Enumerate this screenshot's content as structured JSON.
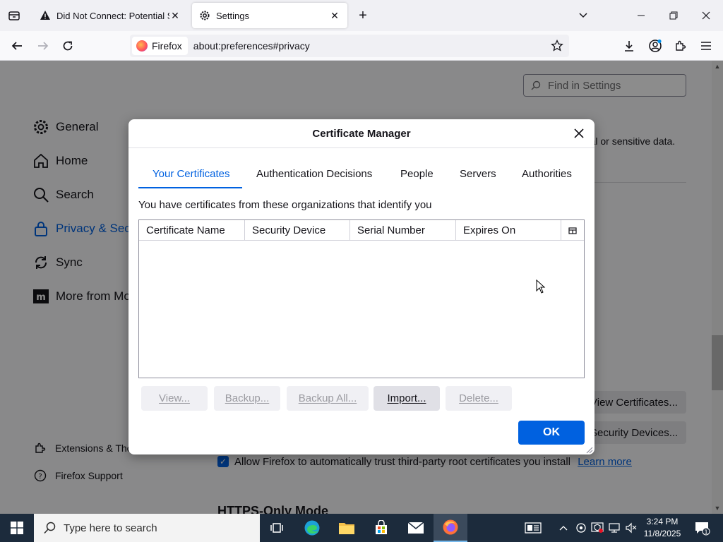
{
  "tabs": [
    {
      "title": "Did Not Connect: Potential Secu",
      "icon": "warning-icon",
      "active": false
    },
    {
      "title": "Settings",
      "icon": "gear-icon",
      "active": true
    }
  ],
  "urlbar": {
    "identity_label": "Firefox",
    "url": "about:preferences#privacy"
  },
  "settings": {
    "find_placeholder": "Find in Settings",
    "sidebar": [
      {
        "label": "General",
        "icon": "gear-icon"
      },
      {
        "label": "Home",
        "icon": "home-icon"
      },
      {
        "label": "Search",
        "icon": "search-icon"
      },
      {
        "label": "Privacy & Secu",
        "icon": "lock-icon"
      },
      {
        "label": "Sync",
        "icon": "sync-icon"
      },
      {
        "label": "More from Mo",
        "icon": "mozilla-icon"
      }
    ],
    "sidebar_footer": [
      {
        "label": "Extensions & The",
        "icon": "puzzle-icon"
      },
      {
        "label": "Firefox Support",
        "icon": "help-icon"
      }
    ],
    "bg_fragment": "onal or sensitive data.",
    "view_certificates": "View Certificates...",
    "security_devices": "Security Devices...",
    "trust_checkbox_label": "Allow Firefox to automatically trust third-party root certificates you install",
    "learn_more": "Learn more",
    "https_heading": "HTTPS-Only Mode"
  },
  "dialog": {
    "title": "Certificate Manager",
    "tabs": [
      "Your Certificates",
      "Authentication Decisions",
      "People",
      "Servers",
      "Authorities"
    ],
    "active_tab": "Your Certificates",
    "description": "You have certificates from these organizations that identify you",
    "columns": [
      "Certificate Name",
      "Security Device",
      "Serial Number",
      "Expires On"
    ],
    "rows": [],
    "buttons": {
      "view": "View...",
      "backup": "Backup...",
      "backup_all": "Backup All...",
      "import": "Import...",
      "delete": "Delete..."
    },
    "ok": "OK"
  },
  "taskbar": {
    "search_placeholder": "Type here to search",
    "time": "3:24 PM",
    "date": "11/8/2025",
    "notification_count": "1"
  },
  "colors": {
    "accent": "#0061e0",
    "taskbar": "#1c2b3c"
  }
}
